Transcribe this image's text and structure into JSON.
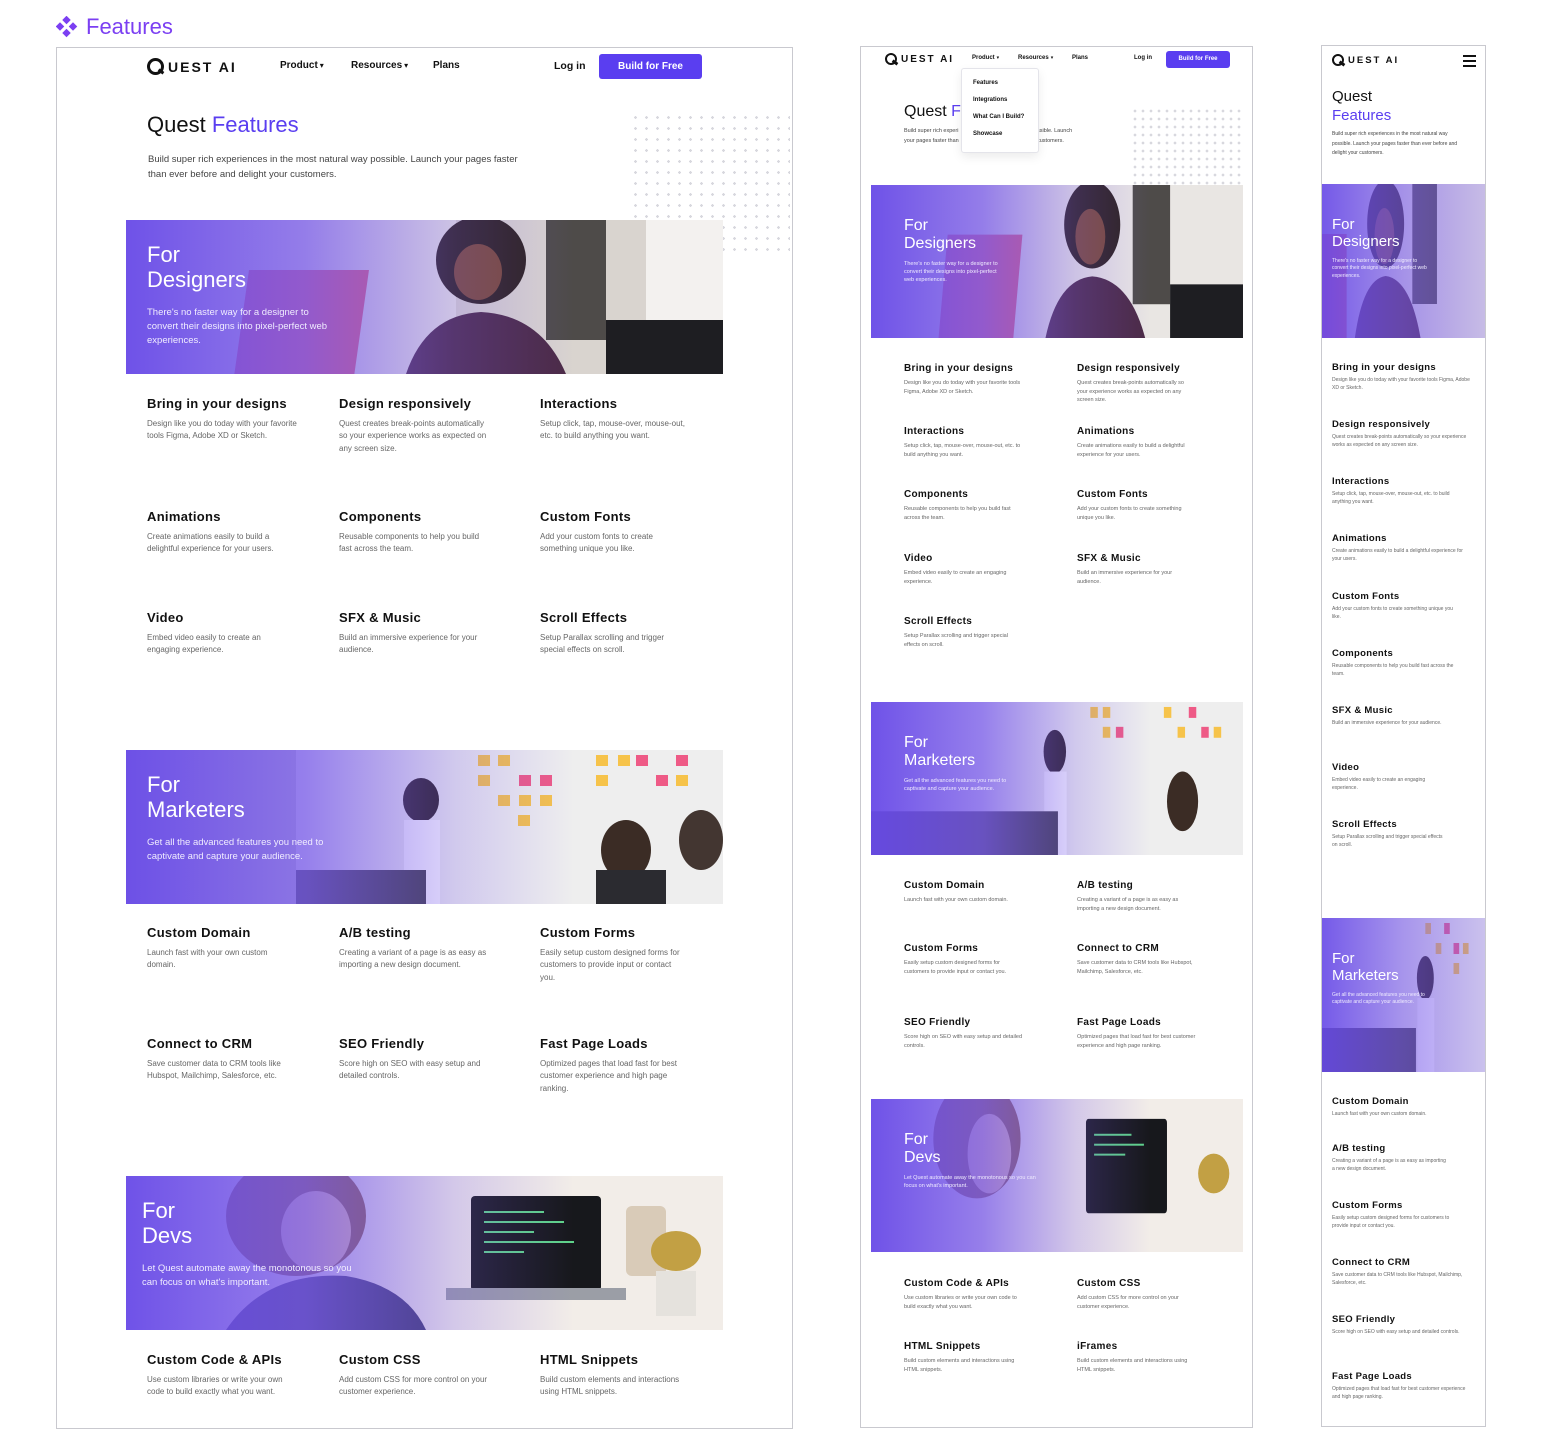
{
  "page_title": "Features",
  "accent_color": "#5a3ef0",
  "nav": {
    "logo": "UEST AI",
    "product": "Product",
    "resources": "Resources",
    "plans": "Plans",
    "login": "Log in",
    "cta": "Build for Free"
  },
  "dropdown": [
    "Features",
    "Integrations",
    "What Can I Build?",
    "Showcase"
  ],
  "header": {
    "title_a": "Quest",
    "title_b": "Features",
    "subtitle_desktop": "Build super rich experiences in the most natural way possible. Launch your pages faster than ever before and delight your customers.",
    "subtitle_tablet_a": "Build super rich experi",
    "subtitle_tablet_b": "ssible. Launch",
    "subtitle_tablet_c": "your pages faster than",
    "subtitle_tablet_d": "customers."
  },
  "sections": {
    "designers": {
      "line1": "For",
      "line2": "Designers",
      "desc": "There's no faster way for a designer to convert their designs into pixel-perfect web experiences."
    },
    "marketers": {
      "line1": "For",
      "line2": "Marketers",
      "desc": "Get all the advanced features you need to captivate and capture your audience."
    },
    "devs": {
      "line1": "For",
      "line2": "Devs",
      "desc": "Let Quest automate away the monotonous so you can focus on what's important."
    }
  },
  "features": {
    "bring": {
      "title": "Bring in your designs",
      "desc": "Design like you do today with your favorite tools Figma, Adobe XD or Sketch."
    },
    "responsive": {
      "title": "Design responsively",
      "desc": "Quest creates break-points automatically so your experience works as expected on any screen size."
    },
    "interactions": {
      "title": "Interactions",
      "desc": "Setup click, tap, mouse-over, mouse-out, etc. to build anything you want."
    },
    "animations": {
      "title": "Animations",
      "desc": "Create animations easily to build a delightful experience for your users."
    },
    "components": {
      "title": "Components",
      "desc": "Reusable components to help you build fast across the team."
    },
    "fonts": {
      "title": "Custom Fonts",
      "desc": "Add your custom fonts to create something unique you like."
    },
    "video": {
      "title": "Video",
      "desc": "Embed video easily to create an engaging experience."
    },
    "sfx": {
      "title": "SFX & Music",
      "desc": "Build an immersive experience for your audience."
    },
    "scroll": {
      "title": "Scroll Effects",
      "desc": "Setup Parallax scrolling and trigger special effects on scroll."
    },
    "domain": {
      "title": "Custom Domain",
      "desc": "Launch fast with your own custom domain."
    },
    "ab": {
      "title": "A/B testing",
      "desc": "Creating a variant of a page is as easy as importing a new design document."
    },
    "forms": {
      "title": "Custom Forms",
      "desc": "Easily setup custom designed forms for customers to provide input or contact you."
    },
    "crm": {
      "title": "Connect to CRM",
      "desc": "Save customer data to CRM tools like Hubspot, Mailchimp, Salesforce, etc."
    },
    "seo": {
      "title": "SEO Friendly",
      "desc": "Score high on SEO with easy setup and detailed controls."
    },
    "fast": {
      "title": "Fast Page Loads",
      "desc": "Optimized pages that load fast for best customer experience and high page ranking."
    },
    "code": {
      "title": "Custom Code & APIs",
      "desc": "Use custom libraries or write your own code to build exactly what you want."
    },
    "css": {
      "title": "Custom CSS",
      "desc": "Add custom CSS for more control on your customer experience."
    },
    "html": {
      "title": "HTML Snippets",
      "desc": "Build custom elements and interactions using HTML snippets."
    },
    "iframes": {
      "title": "iFrames",
      "desc": "Build custom elements and interactions using HTML snippets."
    }
  }
}
